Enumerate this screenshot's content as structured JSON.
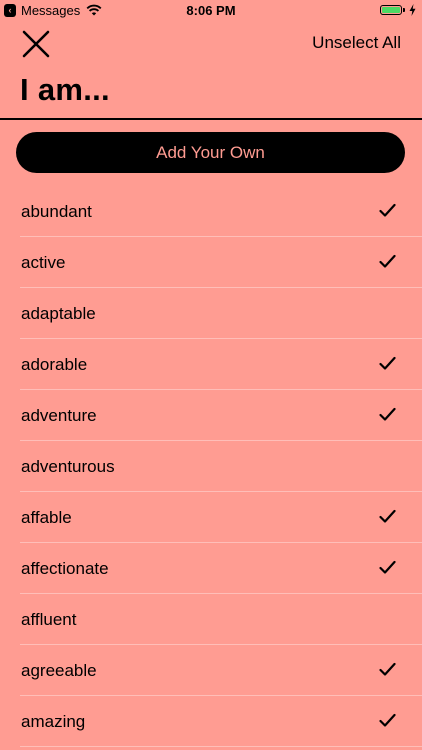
{
  "status_bar": {
    "back_app": "Messages",
    "time": "8:06 PM",
    "battery_color": "#4CD964"
  },
  "header": {
    "close_icon": "close-icon",
    "unselect_label": "Unselect All",
    "title": "I am..."
  },
  "add_button_label": "Add Your Own",
  "colors": {
    "background": "#FF9C92",
    "button_bg": "#000000",
    "button_text": "#FF9C92"
  },
  "items": [
    {
      "label": "abundant",
      "checked": true
    },
    {
      "label": "active",
      "checked": true
    },
    {
      "label": "adaptable",
      "checked": false
    },
    {
      "label": "adorable",
      "checked": true
    },
    {
      "label": "adventure",
      "checked": true
    },
    {
      "label": "adventurous",
      "checked": false
    },
    {
      "label": "affable",
      "checked": true
    },
    {
      "label": "affectionate",
      "checked": true
    },
    {
      "label": "affluent",
      "checked": false
    },
    {
      "label": "agreeable",
      "checked": true
    },
    {
      "label": "amazing",
      "checked": true
    }
  ]
}
